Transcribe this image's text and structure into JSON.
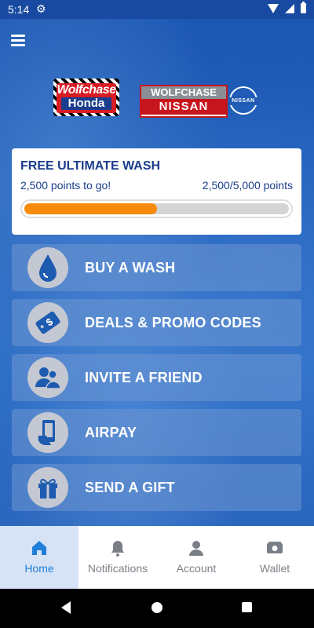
{
  "status_bar": {
    "time": "5:14"
  },
  "logos": {
    "honda_line1": "Wolfchase",
    "honda_line2": "Honda",
    "nissan_line1": "WOLFCHASE",
    "nissan_line2": "NISSAN",
    "nissan_mark": "NISSAN"
  },
  "rewards": {
    "title": "FREE ULTIMATE WASH",
    "points_to_go": "2,500 points to go!",
    "points_progress": "2,500/5,000 points",
    "progress_fraction": 0.5,
    "fill_color": "#f58a0b"
  },
  "actions": [
    {
      "label": "BUY A WASH",
      "icon": "water-drop-icon"
    },
    {
      "label": "DEALS & PROMO CODES",
      "icon": "coupon-tag-icon"
    },
    {
      "label": "INVITE A FRIEND",
      "icon": "invite-people-icon"
    },
    {
      "label": "AIRPAY",
      "icon": "phone-pay-icon"
    },
    {
      "label": "SEND A GIFT",
      "icon": "gift-icon"
    }
  ],
  "bottom_nav": [
    {
      "label": "Home",
      "icon": "home-icon",
      "active": true
    },
    {
      "label": "Notifications",
      "icon": "bell-icon",
      "active": false
    },
    {
      "label": "Account",
      "icon": "person-icon",
      "active": false
    },
    {
      "label": "Wallet",
      "icon": "wallet-icon",
      "active": false
    }
  ]
}
